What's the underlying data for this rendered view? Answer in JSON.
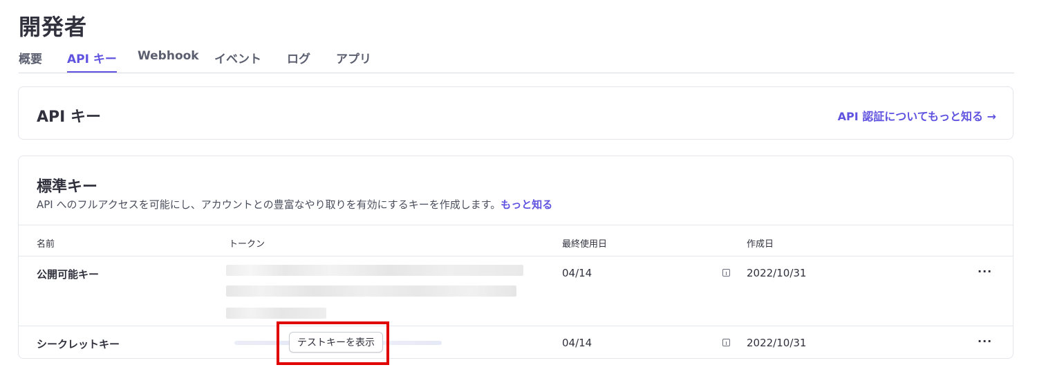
{
  "page": {
    "title": "開発者"
  },
  "tabs": [
    {
      "label": "概要",
      "active": false
    },
    {
      "label": "API キー",
      "active": true
    },
    {
      "label": "Webhook",
      "active": false
    },
    {
      "label": "イベント",
      "active": false
    },
    {
      "label": "ログ",
      "active": false
    },
    {
      "label": "アプリ",
      "active": false
    }
  ],
  "api_keys_card": {
    "title": "API キー",
    "learn_link": "API 認証についてもっと知る →"
  },
  "standard_keys": {
    "title": "標準キー",
    "description": "API へのフルアクセスを可能にし、アカウントとの豊富なやり取りを有効にするキーを作成します。",
    "learn_more": "もっと知る",
    "columns": {
      "name": "名前",
      "token": "トークン",
      "last_used": "最終使用日",
      "created": "作成日"
    },
    "rows": [
      {
        "name": "公開可能キー",
        "last_used": "04/14",
        "created": "2022/10/31"
      },
      {
        "name": "シークレットキー",
        "last_used": "04/14",
        "created": "2022/10/31",
        "reveal_label": "テストキーを表示"
      }
    ],
    "more_symbol": "···"
  },
  "colors": {
    "accent": "#5f53e0",
    "text": "#30313d",
    "highlight": "#e00000",
    "border": "#e3e6ec"
  },
  "icons": {
    "info": "info-icon",
    "more": "more-icon"
  }
}
